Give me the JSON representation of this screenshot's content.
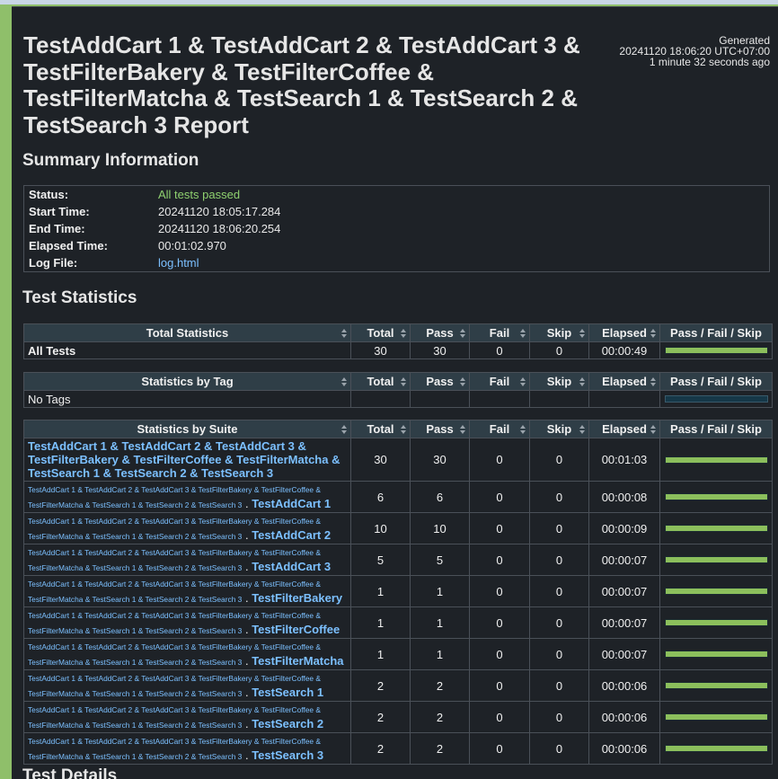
{
  "header": {
    "title": "TestAddCart 1 & TestAddCart 2 & TestAddCart 3 & TestFilterBakery & TestFilterCoffee & TestFilterMatcha & TestSearch 1 & TestSearch 2 & TestSearch 3 Report",
    "generated_label": "Generated",
    "generated_time": "20241120 18:06:20 UTC+07:00",
    "generated_ago": "1 minute 32 seconds ago"
  },
  "summary": {
    "heading": "Summary Information",
    "status_label": "Status:",
    "status_value": "All tests passed",
    "start_label": "Start Time:",
    "start_value": "20241120 18:05:17.284",
    "end_label": "End Time:",
    "end_value": "20241120 18:06:20.254",
    "elapsed_label": "Elapsed Time:",
    "elapsed_value": "00:01:02.970",
    "log_label": "Log File:",
    "log_value": "log.html"
  },
  "statistics": {
    "heading": "Test Statistics",
    "columns": {
      "total": "Total",
      "pass": "Pass",
      "fail": "Fail",
      "skip": "Skip",
      "elapsed": "Elapsed",
      "bar": "Pass / Fail / Skip"
    },
    "total_header": "Total Statistics",
    "total_row": {
      "name": "All Tests",
      "total": "30",
      "pass": "30",
      "fail": "0",
      "skip": "0",
      "elapsed": "00:00:49",
      "pass_ratio": 1.0
    },
    "tag_header": "Statistics by Tag",
    "tag_row": {
      "name": "No Tags"
    },
    "suite_header": "Statistics by Suite",
    "suite_prefix": "TestAddCart 1 & TestAddCart 2 & TestAddCart 3 & TestFilterBakery & TestFilterCoffee & TestFilterMatcha & TestSearch 1 & TestSearch 2 & TestSearch 3",
    "suites": [
      {
        "name": "TestAddCart 1 & TestAddCart 2 & TestAddCart 3 & TestFilterBakery & TestFilterCoffee & TestFilterMatcha & TestSearch 1 & TestSearch 2 & TestSearch 3",
        "total": "30",
        "pass": "30",
        "fail": "0",
        "skip": "0",
        "elapsed": "00:01:03",
        "pass_ratio": 1.0,
        "top": true
      },
      {
        "name": "TestAddCart 1",
        "total": "6",
        "pass": "6",
        "fail": "0",
        "skip": "0",
        "elapsed": "00:00:08",
        "pass_ratio": 1.0
      },
      {
        "name": "TestAddCart 2",
        "total": "10",
        "pass": "10",
        "fail": "0",
        "skip": "0",
        "elapsed": "00:00:09",
        "pass_ratio": 1.0
      },
      {
        "name": "TestAddCart 3",
        "total": "5",
        "pass": "5",
        "fail": "0",
        "skip": "0",
        "elapsed": "00:00:07",
        "pass_ratio": 1.0
      },
      {
        "name": "TestFilterBakery",
        "total": "1",
        "pass": "1",
        "fail": "0",
        "skip": "0",
        "elapsed": "00:00:07",
        "pass_ratio": 1.0
      },
      {
        "name": "TestFilterCoffee",
        "total": "1",
        "pass": "1",
        "fail": "0",
        "skip": "0",
        "elapsed": "00:00:07",
        "pass_ratio": 1.0
      },
      {
        "name": "TestFilterMatcha",
        "total": "1",
        "pass": "1",
        "fail": "0",
        "skip": "0",
        "elapsed": "00:00:07",
        "pass_ratio": 1.0
      },
      {
        "name": "TestSearch 1",
        "total": "2",
        "pass": "2",
        "fail": "0",
        "skip": "0",
        "elapsed": "00:00:06",
        "pass_ratio": 1.0
      },
      {
        "name": "TestSearch 2",
        "total": "2",
        "pass": "2",
        "fail": "0",
        "skip": "0",
        "elapsed": "00:00:06",
        "pass_ratio": 1.0
      },
      {
        "name": "TestSearch 3",
        "total": "2",
        "pass": "2",
        "fail": "0",
        "skip": "0",
        "elapsed": "00:00:06",
        "pass_ratio": 1.0
      }
    ]
  },
  "details": {
    "heading": "Test Details"
  },
  "colors": {
    "pass": "#8cbf5c",
    "background": "#1e2227",
    "link": "#7cc0ff",
    "header_bg": "#2f3e47"
  }
}
